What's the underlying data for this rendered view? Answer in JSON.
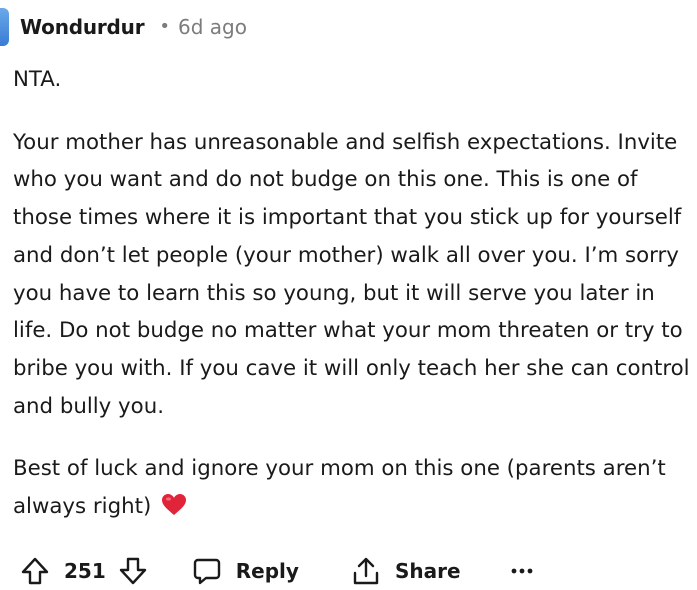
{
  "comment": {
    "author": "Wondurdur",
    "separator": "•",
    "age": "6d ago",
    "paragraphs": [
      "NTA.",
      "Your mother has unreasonable and selfish expectations. Invite who you want and do not budge on this one. This is one of those times where it is important that you stick up for yourself and don’t let people (your mother) walk all over you. I’m sorry you have to learn this so young, but it will serve you later in life. Do not budge no matter what your mom threaten or try to bribe you with. If you cave it will only teach her she can control and bully you.",
      "Best of luck and ignore your mom on this one (parents aren’t always right)"
    ]
  },
  "actions": {
    "score": "251",
    "reply_label": "Reply",
    "share_label": "Share"
  },
  "icons": {
    "avatar": "avatar-icon",
    "upvote": "upvote-arrow-icon",
    "downvote": "downvote-arrow-icon",
    "reply": "speech-bubble-icon",
    "share": "share-icon",
    "more": "ellipsis-icon",
    "heart": "red-heart-emoji"
  },
  "colors": {
    "text": "#1a1a1b",
    "muted": "#7c7c7c",
    "heart": "#e0243a",
    "avatar": "#3a7bd5"
  }
}
